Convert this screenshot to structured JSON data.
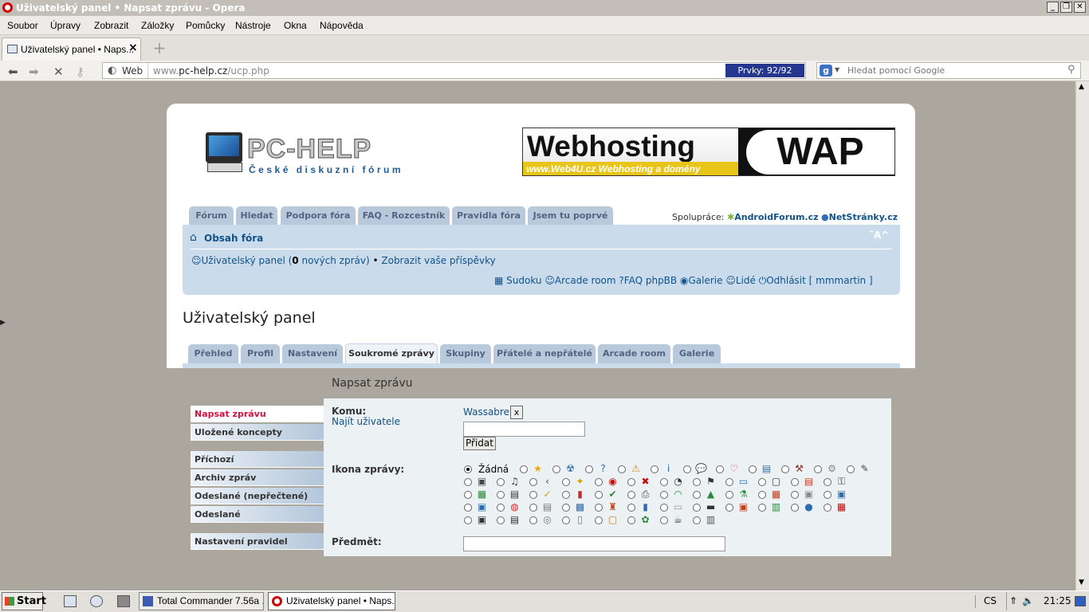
{
  "window": {
    "title": "Uživatelský panel • Napsat zprávu - Opera"
  },
  "menu": [
    "Soubor",
    "Úpravy",
    "Zobrazit",
    "Záložky",
    "Pomůcky",
    "Nástroje",
    "Okna",
    "Nápověda"
  ],
  "tab": {
    "label": "Uživatelský panel • Naps..."
  },
  "address": {
    "web_label": "Web",
    "url_host": "www.",
    "url_domain": "pc-help.cz",
    "url_path": "/ucp.php",
    "elements_count": "Prvky:  92/92"
  },
  "search": {
    "placeholder": "Hledat pomocí Google"
  },
  "site": {
    "logo_title": "PC-HELP",
    "logo_subtitle": "České diskuzní fórum",
    "banner_left": "Webhosting",
    "banner_sub": "www.Web4U.cz  Webhosting a domény",
    "banner_right": "WAP",
    "nav_tabs": [
      "Fórum",
      "Hledat",
      "Podpora fóra",
      "FAQ - Rozcestník",
      "Pravidla fóra",
      "Jsem tu poprvé"
    ],
    "partners_label": "Spolupráce:",
    "partner1": "AndroidForum.cz",
    "partner2": "NetStránky.cz",
    "index_link": "Obsah fóra",
    "font_ctrl": "ˇA^",
    "ucp_link": "Uživatelský panel",
    "new_count": "0",
    "new_label": "nových zpráv",
    "show_posts": "Zobrazit vaše příspěvky",
    "links": {
      "sudoku": "Sudoku",
      "arcade": "Arcade room",
      "faq": "FAQ phpBB",
      "gallery": "Galerie",
      "people": "Lidé",
      "logout": "Odhlásit [ mmmartin ]"
    }
  },
  "ucp": {
    "heading": "Uživatelský panel",
    "tabs": [
      "Přehled",
      "Profil",
      "Nastavení",
      "Soukromé zprávy",
      "Skupiny",
      "Přátelé a nepřátelé",
      "Arcade room",
      "Galerie"
    ],
    "active_tab": "Soukromé zprávy",
    "section_title": "Napsat zprávu",
    "sidebar": [
      "Napsat zprávu",
      "Uložené koncepty",
      "Příchozí",
      "Archiv zpráv",
      "Odeslané (nepřečtené)",
      "Odeslané",
      "Nastavení pravidel"
    ],
    "to_label": "Komu:",
    "recipient": "Wassabre",
    "remove": "x",
    "find_user": "Najít uživatele",
    "add_button": "Přidat",
    "icon_label": "Ikona zprávy:",
    "icon_none": "Žádná",
    "subject_label": "Předmět:"
  },
  "taskbar": {
    "start": "Start",
    "tasks": [
      "Total Commander 7.56a ...",
      "Uživatelský panel • Naps..."
    ],
    "lang": "CS",
    "clock": "21:25"
  }
}
